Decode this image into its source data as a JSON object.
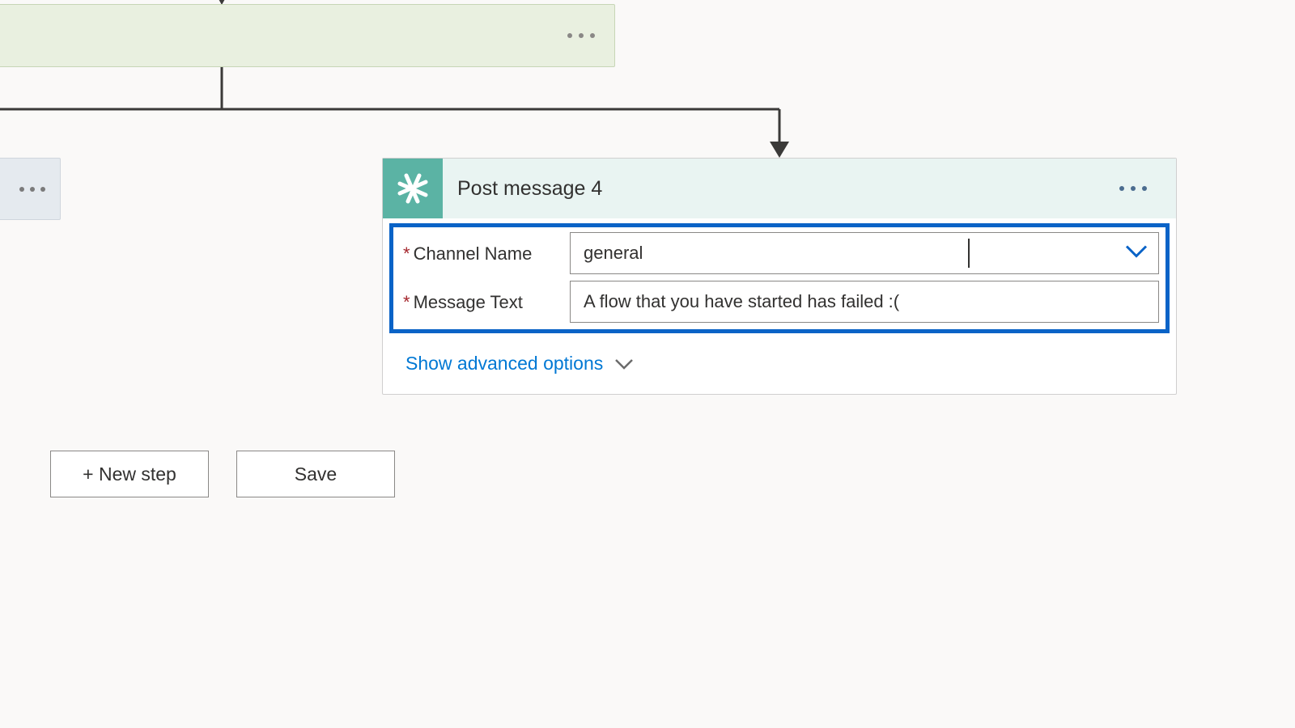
{
  "action_card": {
    "title": "Post message 4",
    "fields": {
      "channel_name": {
        "label": "Channel Name",
        "value": "general"
      },
      "message_text": {
        "label": "Message Text",
        "value": "A flow that you have started has failed :("
      }
    },
    "advanced_options_label": "Show advanced options"
  },
  "buttons": {
    "new_step": "+ New step",
    "save": "Save"
  }
}
